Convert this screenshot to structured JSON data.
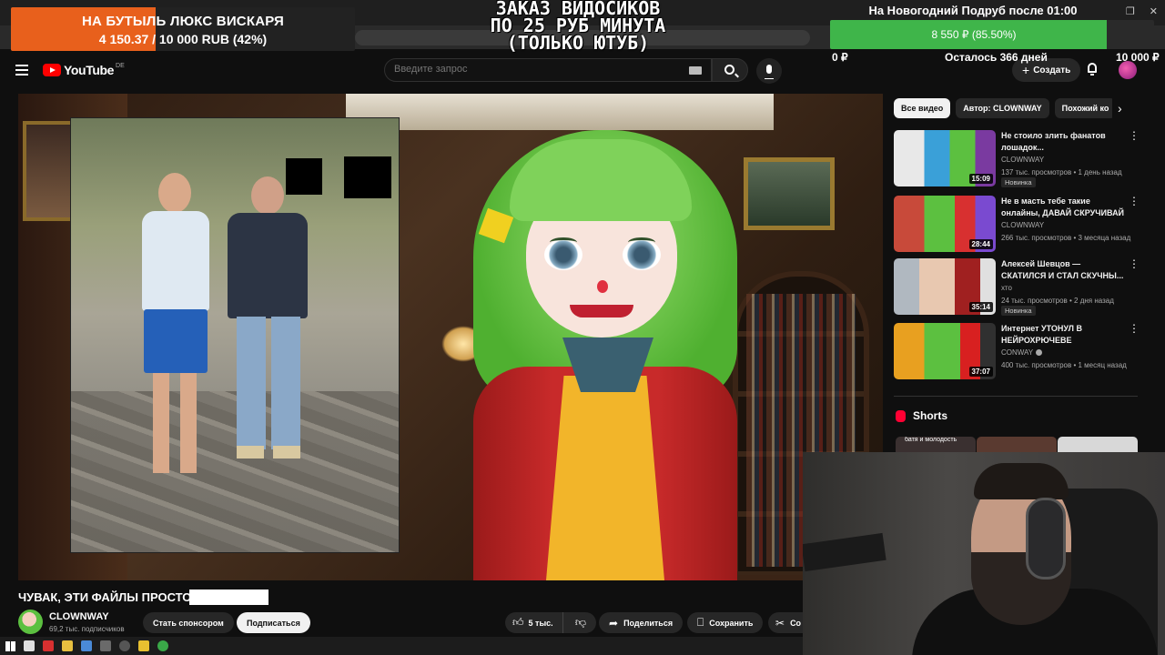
{
  "stream_overlay": {
    "donation_goal": {
      "title": "НА БУТЫЛЬ ЛЮКС ВИСКАРЯ",
      "amount_text": "4 150.37 / 10 000 RUB (42%)",
      "progress_percent": 42,
      "fill_color": "#e8601c"
    },
    "order_banner": {
      "lines": [
        "ЗАКАЗ ВИДОСИКОВ",
        "ПО 25 РУБ МИНУТА",
        "(ТОЛЬКО ЮТУБ)"
      ]
    },
    "subathon_goal": {
      "title": "На Новогодний Подруб после 01:00",
      "amount_text": "8 550 ₽ (85.50%)",
      "progress_percent": 85.5,
      "min_label": "0 ₽",
      "remaining_label": "Осталось 366 дней",
      "max_label": "10 000 ₽",
      "fill_color": "#3fb54a"
    }
  },
  "youtube": {
    "header": {
      "logo_text": "YouTube",
      "region": "DE",
      "search_placeholder": "Введите запрос",
      "create_label": "Создать"
    },
    "video": {
      "title": "ЧУВАК, ЭТИ ФАЙЛЫ ПРОСТО",
      "channel_name": "CLOWNWAY",
      "subscribers": "69,2 тыс. подписчиков",
      "sponsor_label": "Стать спонсором",
      "subscribe_label": "Подписаться",
      "likes": "5 тыс.",
      "share_label": "Поделиться",
      "save_label": "Сохранить",
      "clip_label": "Со"
    },
    "chips": [
      "Все видео",
      "Автор: CLOWNWAY",
      "Похожий ко"
    ],
    "recommendations": [
      {
        "title": "Не стоило злить фанатов лошадок...",
        "channel": "CLOWNWAY",
        "stats": "137 тыс. просмотров • 1 день назад",
        "badge": "Новинка",
        "duration": "15:09",
        "verified": false
      },
      {
        "title": "Не в масть тебе такие онлайны, ДАВАЙ СКРУЧИВАЙ",
        "channel": "CLOWNWAY",
        "stats": "266 тыс. просмотров • 3 месяца назад",
        "badge": "",
        "duration": "28:44",
        "verified": false
      },
      {
        "title": "Алексей Шевцов — СКАТИЛСЯ И СТАЛ СКУЧНЫ...",
        "channel": "хто",
        "stats": "24 тыс. просмотров • 2 дня назад",
        "badge": "Новинка",
        "duration": "35:14",
        "verified": false
      },
      {
        "title": "Интернет УТОНУЛ В НЕЙРОХРЮЧЕВЕ",
        "channel": "CONWAY",
        "stats": "400 тыс. просмотров • 1 месяц назад",
        "badge": "",
        "duration": "37:07",
        "verified": true
      }
    ],
    "shorts": {
      "label": "Shorts",
      "first_caption": "батя и молодость"
    }
  }
}
